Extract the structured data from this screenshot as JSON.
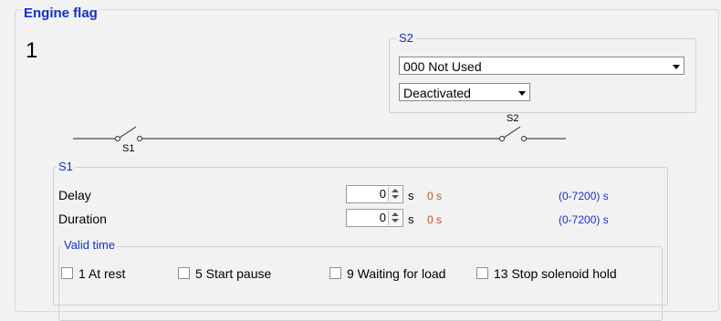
{
  "title": "Engine flag",
  "number": "1",
  "s2": {
    "label": "S2",
    "function_value": "000 Not Used",
    "mode_value": "Deactivated"
  },
  "diagram": {
    "s1_label": "S1",
    "s2_label": "S2"
  },
  "s1": {
    "label": "S1",
    "rows": [
      {
        "label": "Delay",
        "value": "0",
        "unit": "s",
        "actual": "0 s",
        "range": "(0-7200) s"
      },
      {
        "label": "Duration",
        "value": "0",
        "unit": "s",
        "actual": "0 s",
        "range": "(0-7200) s"
      }
    ],
    "valid_time": {
      "label": "Valid time",
      "options": [
        {
          "label": "1 At rest",
          "checked": false
        },
        {
          "label": "5 Start pause",
          "checked": false
        },
        {
          "label": "9 Waiting for load",
          "checked": false
        },
        {
          "label": "13 Stop solenoid hold",
          "checked": false
        }
      ]
    }
  }
}
